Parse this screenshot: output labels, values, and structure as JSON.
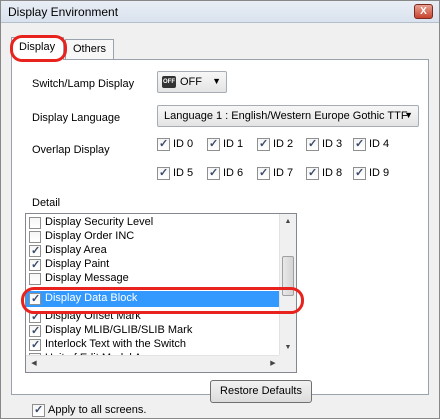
{
  "window": {
    "title": "Display Environment",
    "close_label": "X"
  },
  "tabs": [
    {
      "label": "Display",
      "active": true
    },
    {
      "label": "Others",
      "active": false
    }
  ],
  "switch_lamp": {
    "label": "Switch/Lamp Display",
    "value": "OFF",
    "icon_text": "OFF"
  },
  "display_language": {
    "label": "Display Language",
    "value": "Language 1 : English/Western Europe Gothic TTF"
  },
  "overlap_display": {
    "label": "Overlap Display",
    "ids": [
      {
        "label": "ID 0",
        "checked": true
      },
      {
        "label": "ID 1",
        "checked": true
      },
      {
        "label": "ID 2",
        "checked": true
      },
      {
        "label": "ID 3",
        "checked": true
      },
      {
        "label": "ID 4",
        "checked": true
      },
      {
        "label": "ID 5",
        "checked": true
      },
      {
        "label": "ID 6",
        "checked": true
      },
      {
        "label": "ID 7",
        "checked": true
      },
      {
        "label": "ID 8",
        "checked": true
      },
      {
        "label": "ID 9",
        "checked": true
      }
    ]
  },
  "detail": {
    "label": "Detail",
    "items": [
      {
        "label": "Display Security Level",
        "checked": false,
        "selected": false
      },
      {
        "label": "Display Order INC",
        "checked": false,
        "selected": false
      },
      {
        "label": "Display Area",
        "checked": true,
        "selected": false
      },
      {
        "label": "Display Paint",
        "checked": true,
        "selected": false
      },
      {
        "label": "Display Message",
        "checked": false,
        "selected": false
      },
      {
        "label": "Display Data Block",
        "checked": true,
        "selected": true
      },
      {
        "label": "Display Offset Mark",
        "checked": true,
        "selected": false
      },
      {
        "label": "Display MLIB/GLIB/SLIB Mark",
        "checked": true,
        "selected": false
      },
      {
        "label": "Interlock Text with the Switch",
        "checked": true,
        "selected": false
      },
      {
        "label": "Unit of Edit Model A",
        "checked": false,
        "selected": false
      }
    ]
  },
  "restore_defaults_label": "Restore Defaults",
  "apply_all": {
    "label": "Apply to all screens.",
    "checked": true
  },
  "colors": {
    "selection": "#3399ff",
    "highlight": "#e8221c",
    "close": "#c7432d"
  }
}
